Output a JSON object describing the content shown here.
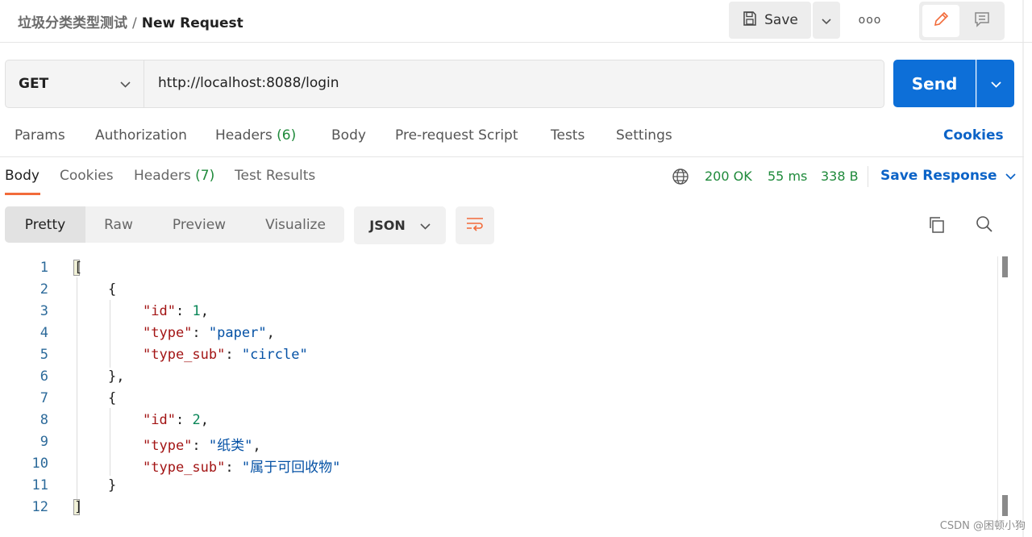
{
  "header": {
    "collection": "垃圾分类类型测试",
    "separator": "/",
    "request_name": "New Request",
    "save_label": "Save",
    "more_label": "ooo"
  },
  "request": {
    "method": "GET",
    "url": "http://localhost:8088/login",
    "send_label": "Send"
  },
  "request_tabs": {
    "params": "Params",
    "authorization": "Authorization",
    "headers": "Headers",
    "headers_count": "(6)",
    "body": "Body",
    "prerequest": "Pre-request Script",
    "tests": "Tests",
    "settings": "Settings",
    "cookies": "Cookies"
  },
  "response_tabs": {
    "body": "Body",
    "cookies": "Cookies",
    "headers": "Headers",
    "headers_count": "(7)",
    "test_results": "Test Results"
  },
  "status": {
    "code": "200 OK",
    "time": "55 ms",
    "size": "338 B",
    "save_response": "Save Response"
  },
  "view": {
    "pretty": "Pretty",
    "raw": "Raw",
    "preview": "Preview",
    "visualize": "Visualize",
    "format": "JSON"
  },
  "code": {
    "line_numbers": [
      "1",
      "2",
      "3",
      "4",
      "5",
      "6",
      "7",
      "8",
      "9",
      "10",
      "11",
      "12"
    ],
    "k_id": "\"id\"",
    "k_type": "\"type\"",
    "k_type_sub": "\"type_sub\"",
    "v_id_1": "1",
    "v_type_1": "\"paper\"",
    "v_sub_1": "\"circle\"",
    "v_id_2": "2",
    "v_type_2": "\"纸类\"",
    "v_sub_2": "\"属于可回收物\""
  },
  "watermark": "CSDN @困顿小狗",
  "colors": {
    "send": "#0d6fd8",
    "accent": "#f26b3a",
    "status_green": "#1f8a3b",
    "link_blue": "#0b63c7"
  }
}
